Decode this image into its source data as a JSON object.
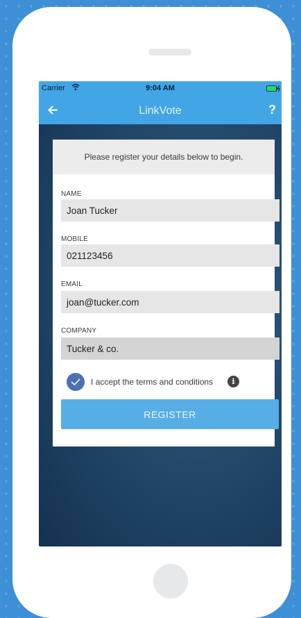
{
  "status_bar": {
    "carrier": "Carrier",
    "time": "9:04 AM",
    "wifi_icon": "wifi-icon",
    "battery_icon": "battery-icon"
  },
  "nav": {
    "title": "LinkVote",
    "back_icon": "arrow-left-icon",
    "help_label": "?"
  },
  "form": {
    "intro": "Please register your details below to begin.",
    "fields": [
      {
        "label": "NAME",
        "value": "Joan Tucker"
      },
      {
        "label": "MOBILE",
        "value": "021123456"
      },
      {
        "label": "EMAIL",
        "value": "joan@tucker.com"
      },
      {
        "label": "COMPANY",
        "value": "Tucker & co."
      }
    ],
    "terms": {
      "label": "I accept the terms and conditions",
      "checked": true,
      "info_icon": "info-icon"
    },
    "register_label": "REGISTER"
  },
  "colors": {
    "accent": "#42a5e6",
    "button": "#57aee6",
    "checkbox": "#4a70b5",
    "page_background": "#3d8fd6"
  }
}
